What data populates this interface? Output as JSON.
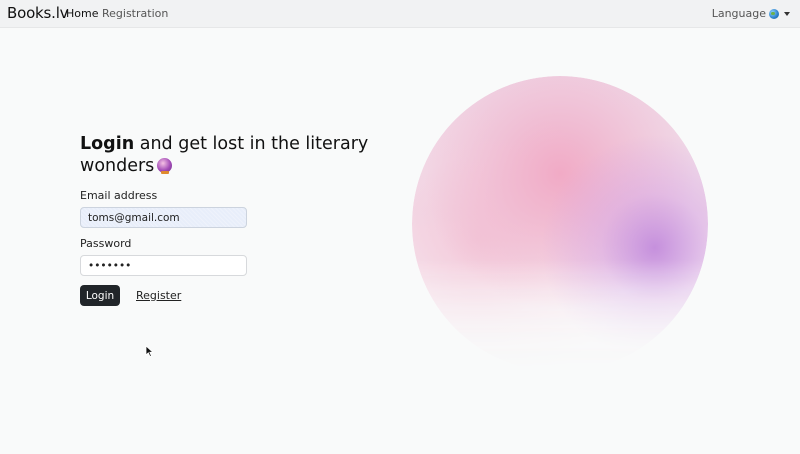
{
  "navbar": {
    "brand": "Books.lv",
    "links": [
      {
        "label": "Home"
      },
      {
        "label": "Registration"
      }
    ],
    "language_label": "Language",
    "language_icon": "globe-icon"
  },
  "login": {
    "heading_bold": "Login",
    "heading_rest": " and get lost in the literary wonders",
    "heading_icon": "crystal-ball-icon",
    "email_label": "Email address",
    "email_value": "toms@gmail.com",
    "password_label": "Password",
    "password_value": "•••••••",
    "login_button": "Login",
    "register_link": "Register"
  },
  "colors": {
    "primary_button": "#212529",
    "navbar_bg": "#f1f2f3",
    "page_bg": "#f9fafa"
  }
}
